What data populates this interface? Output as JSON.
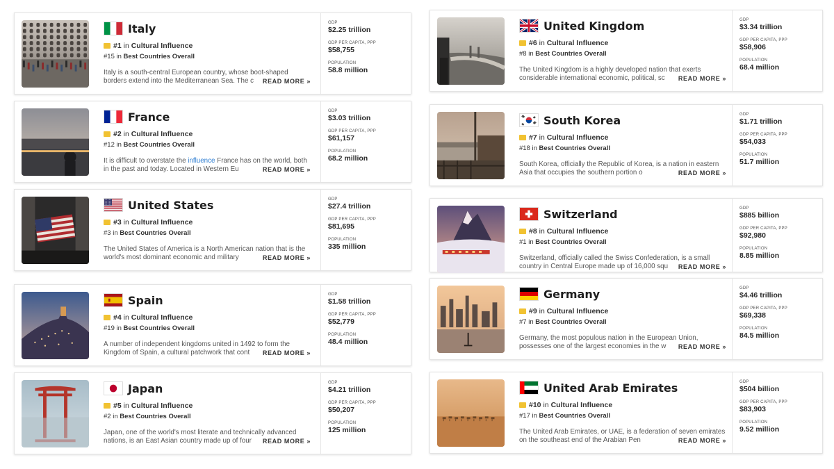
{
  "labels": {
    "in": "in",
    "read_more": "READ MORE »",
    "gdp": "GDP",
    "gdp_per_capita": "GDP PER CAPITA, PPP",
    "population": "POPULATION"
  },
  "countries": [
    {
      "name": "Italy",
      "flag_icon": "italy-flag-icon",
      "photo_icon": "venice-photo",
      "cultural_rank": "#1",
      "cultural_label": "Cultural Influence",
      "overall_rank": "#15",
      "overall_label": "Best Countries Overall",
      "desc_pre": "Italy is a south-central European country, whose boot-shaped borders extend into the Mediterranean Sea. The c",
      "desc_link": "",
      "desc_post": "",
      "gdp": "$2.25 trillion",
      "gdp_per_capita": "$58,755",
      "population": "58.8 million"
    },
    {
      "name": "France",
      "flag_icon": "france-flag-icon",
      "photo_icon": "paris-photo",
      "cultural_rank": "#2",
      "cultural_label": "Cultural Influence",
      "overall_rank": "#12",
      "overall_label": "Best Countries Overall",
      "desc_pre": "It is difficult to overstate the ",
      "desc_link": "influence",
      "desc_post": " France has on the world, both in the past and today. Located in Western Eu",
      "gdp": "$3.03 trillion",
      "gdp_per_capita": "$61,157",
      "population": "68.2 million"
    },
    {
      "name": "United States",
      "flag_icon": "usa-flag-icon",
      "photo_icon": "wall-street-photo",
      "cultural_rank": "#3",
      "cultural_label": "Cultural Influence",
      "overall_rank": "#3",
      "overall_label": "Best Countries Overall",
      "desc_pre": "The United States of America is a North American nation that is the world's most dominant economic and military",
      "desc_link": "",
      "desc_post": "",
      "gdp": "$27.4 trillion",
      "gdp_per_capita": "$81,695",
      "population": "335 million"
    },
    {
      "name": "Spain",
      "flag_icon": "spain-flag-icon",
      "photo_icon": "spanish-town-photo",
      "cultural_rank": "#4",
      "cultural_label": "Cultural Influence",
      "overall_rank": "#19",
      "overall_label": "Best Countries Overall",
      "desc_pre": "A number of independent kingdoms united in 1492 to form the Kingdom of Spain, a cultural patchwork that cont",
      "desc_link": "",
      "desc_post": "",
      "gdp": "$1.58 trillion",
      "gdp_per_capita": "$52,779",
      "population": "48.4 million"
    },
    {
      "name": "Japan",
      "flag_icon": "japan-flag-icon",
      "photo_icon": "torii-gate-photo",
      "cultural_rank": "#5",
      "cultural_label": "Cultural Influence",
      "overall_rank": "#2",
      "overall_label": "Best Countries Overall",
      "desc_pre": "Japan, one of the world's most literate and technically advanced nations, is an East Asian country made up of four",
      "desc_link": "",
      "desc_post": "",
      "gdp": "$4.21 trillion",
      "gdp_per_capita": "$50,207",
      "population": "125 million"
    },
    {
      "name": "United Kingdom",
      "flag_icon": "uk-flag-icon",
      "photo_icon": "london-photo",
      "cultural_rank": "#6",
      "cultural_label": "Cultural Influence",
      "overall_rank": "#8",
      "overall_label": "Best Countries Overall",
      "desc_pre": "The United Kingdom is a highly developed nation that exerts considerable international economic, political, sc",
      "desc_link": "",
      "desc_post": "",
      "gdp": "$3.34 trillion",
      "gdp_per_capita": "$58,906",
      "population": "68.4 million"
    },
    {
      "name": "South Korea",
      "flag_icon": "south-korea-flag-icon",
      "photo_icon": "seoul-photo",
      "cultural_rank": "#7",
      "cultural_label": "Cultural Influence",
      "overall_rank": "#18",
      "overall_label": "Best Countries Overall",
      "desc_pre": "South Korea, officially the Republic of Korea, is a nation in eastern Asia that occupies the southern portion o",
      "desc_link": "",
      "desc_post": "",
      "gdp": "$1.71 trillion",
      "gdp_per_capita": "$54,033",
      "population": "51.7 million"
    },
    {
      "name": "Switzerland",
      "flag_icon": "switzerland-flag-icon",
      "photo_icon": "matterhorn-photo",
      "cultural_rank": "#8",
      "cultural_label": "Cultural Influence",
      "overall_rank": "#1",
      "overall_label": "Best Countries Overall",
      "desc_pre": "Switzerland, officially called the Swiss Confederation, is a small country in Central Europe made up of 16,000 squ",
      "desc_link": "",
      "desc_post": "",
      "gdp": "$885 billion",
      "gdp_per_capita": "$92,980",
      "population": "8.85 million"
    },
    {
      "name": "Germany",
      "flag_icon": "germany-flag-icon",
      "photo_icon": "frankfurt-photo",
      "cultural_rank": "#9",
      "cultural_label": "Cultural Influence",
      "overall_rank": "#7",
      "overall_label": "Best Countries Overall",
      "desc_pre": "Germany, the most populous nation in the European Union, possesses one of the largest economies in the w",
      "desc_link": "",
      "desc_post": "",
      "gdp": "$4.46 trillion",
      "gdp_per_capita": "$69,338",
      "population": "84.5 million"
    },
    {
      "name": "United Arab Emirates",
      "flag_icon": "uae-flag-icon",
      "photo_icon": "desert-caravan-photo",
      "cultural_rank": "#10",
      "cultural_label": "Cultural Influence",
      "overall_rank": "#17",
      "overall_label": "Best Countries Overall",
      "desc_pre": "The United Arab Emirates, or UAE, is a federation of seven emirates on the southeast end of the Arabian Pen",
      "desc_link": "",
      "desc_post": "",
      "gdp": "$504 billion",
      "gdp_per_capita": "$83,903",
      "population": "9.52 million"
    }
  ]
}
